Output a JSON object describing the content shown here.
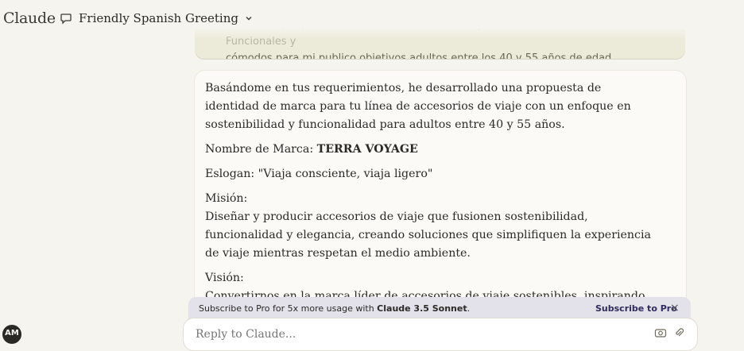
{
  "app": {
    "logo": "Claude",
    "avatar_initials": "AM"
  },
  "header": {
    "chat_title": "Friendly Spanish Greeting"
  },
  "user_message": {
    "line1": "Me inclino por producto sostenibles, sostenibles y de economía circular. Funcionales y",
    "line2": "cómodos para mi publico objetivos adultos entre los 40 y 55 años de edad"
  },
  "assistant_message": {
    "intro": "Basándome en tus requerimientos, he desarrollado una propuesta de identidad de marca para tu línea de accesorios de viaje con un enfoque en sostenibilidad y funcionalidad para adultos entre 40 y 55 años.",
    "brand_label": "Nombre de Marca: ",
    "brand_name": "TERRA VOYAGE",
    "slogan": "Eslogan: \"Viaja consciente, viaja ligero\"",
    "mission_label": "Misión:",
    "mission_text": "Diseñar y producir accesorios de viaje que fusionen sostenibilidad, funcionalidad y elegancia, creando soluciones que simplifiquen la experiencia de viaje mientras respetan el medio ambiente.",
    "vision_label": "Visión:",
    "vision_text": "Convertirnos en la marca líder de accesorios de viaje sostenibles, inspirando una nueva"
  },
  "pro_banner": {
    "text_prefix": "Subscribe to Pro for 5x more usage with ",
    "model": "Claude 3.5 Sonnet",
    "text_suffix": ".",
    "link": "Subscribe to Pro",
    "close_glyph": "×"
  },
  "composer": {
    "placeholder": "Reply to Claude..."
  },
  "icons": {
    "chat": "chat-bubble-icon",
    "chevron": "chevron-down-icon",
    "close": "close-icon",
    "attach": "paperclip-icon",
    "camera": "camera-icon"
  }
}
